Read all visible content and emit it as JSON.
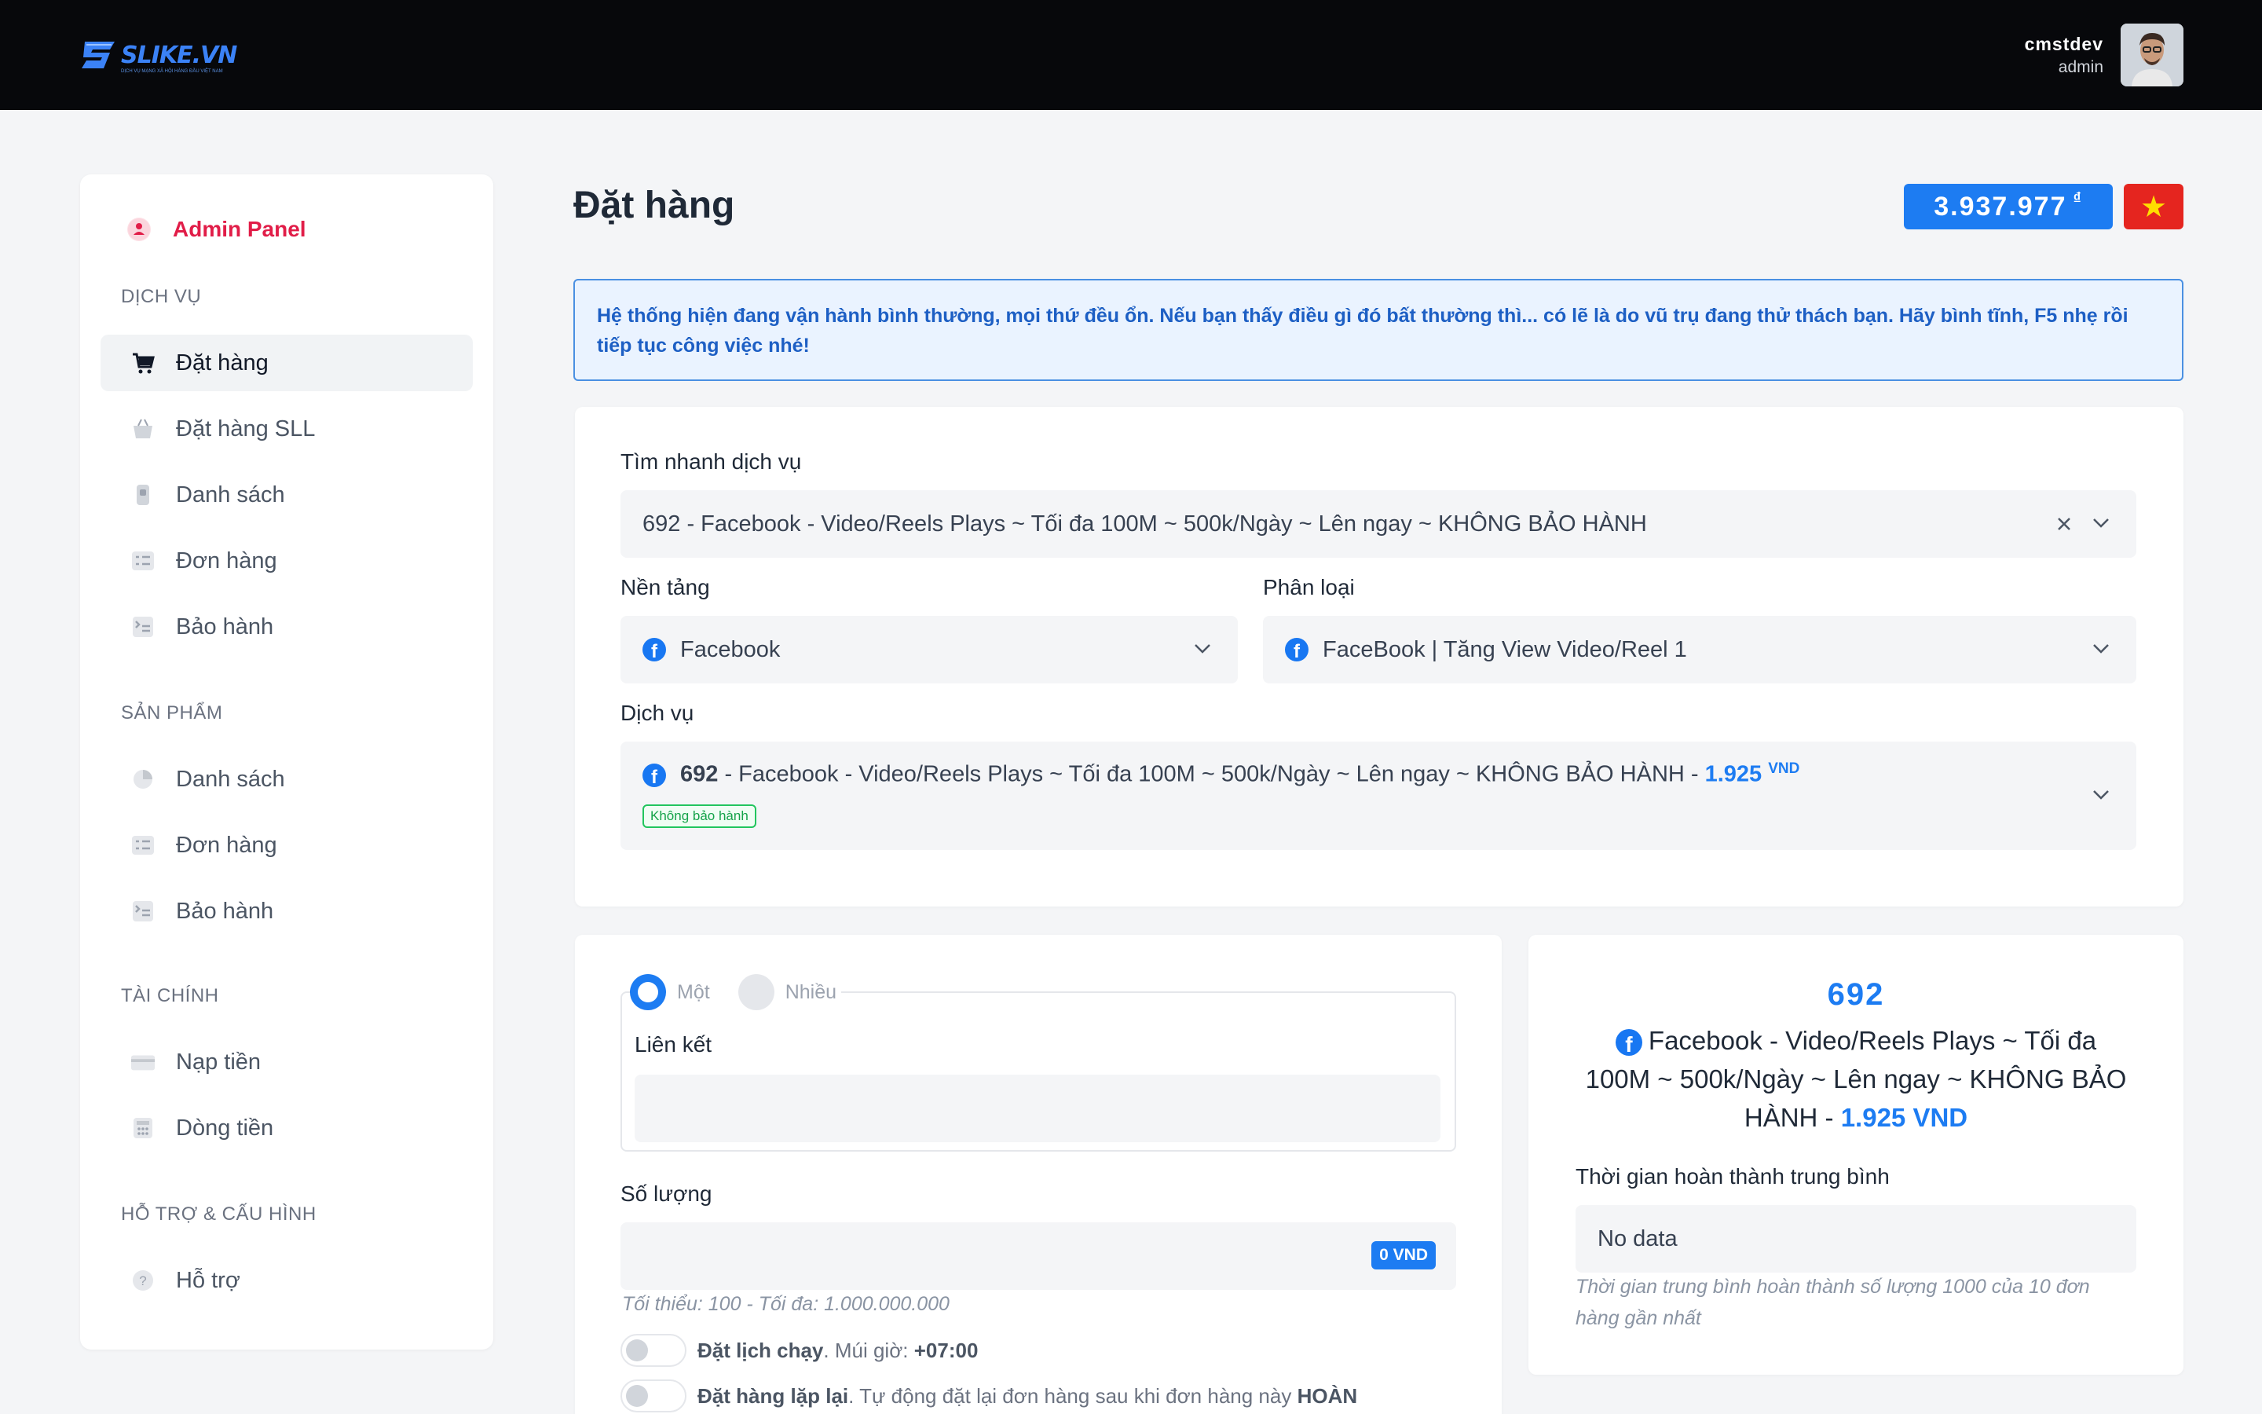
{
  "header": {
    "logo_text": "SLIKE.VN",
    "logo_tagline": "DỊCH VỤ MẠNG XÃ HỘI HÀNG ĐẦU VIỆT NAM",
    "user_name": "cmstdev",
    "user_role": "admin"
  },
  "sidebar": {
    "admin_label": "Admin Panel",
    "sections": {
      "dich_vu": "DỊCH VỤ",
      "san_pham": "SẢN PHẨM",
      "tai_chinh": "TÀI CHÍNH",
      "ho_tro": "HỖ TRỢ & CẤU HÌNH"
    },
    "items": {
      "dat_hang": "Đặt hàng",
      "dat_hang_sll": "Đặt hàng SLL",
      "danh_sach": "Danh sách",
      "don_hang": "Đơn hàng",
      "bao_hanh": "Bảo hành",
      "sp_danh_sach": "Danh sách",
      "sp_don_hang": "Đơn hàng",
      "sp_bao_hanh": "Bảo hành",
      "nap_tien": "Nạp tiền",
      "dong_tien": "Dòng tiền",
      "ho_tro": "Hỗ trợ"
    }
  },
  "page": {
    "title": "Đặt hàng",
    "balance": "3.937.977",
    "currency_symbol": "₫",
    "flag_star": "★",
    "notice": "Hệ thống hiện đang vận hành bình thường, mọi thứ đều ổn. Nếu bạn thấy điều gì đó bất thường thì... có lẽ là do vũ trụ đang thử thách bạn. Hãy bình tĩnh, F5 nhẹ rồi tiếp tục công việc nhé!"
  },
  "form": {
    "quick_search_label": "Tìm nhanh dịch vụ",
    "quick_search_value": "692 - Facebook - Video/Reels Plays ~ Tối đa 100M ~ 500k/Ngày ~ Lên ngay ~ KHÔNG BẢO HÀNH",
    "platform_label": "Nền tảng",
    "platform_value": "Facebook",
    "category_label": "Phân loại",
    "category_value": "FaceBook | Tăng View Video/Reel 1",
    "service_label": "Dịch vụ",
    "service_id": "692",
    "service_name": " - Facebook - Video/Reels Plays ~ Tối đa 100M ~ 500k/Ngày ~ Lên ngay ~ KHÔNG BẢO HÀNH - ",
    "service_price": "1.925",
    "service_currency": "VND",
    "service_badge": "Không bảo hành"
  },
  "order": {
    "mode_one": "Một",
    "mode_many": "Nhiều",
    "link_label": "Liên kết",
    "link_value": "",
    "quantity_label": "Số lượng",
    "quantity_value": "",
    "total_badge": "0 VND",
    "min_max": "Tối thiểu: 100 - Tối đa: 1.000.000.000",
    "schedule_bold": "Đặt lịch chạy",
    "schedule_rest": ". Múi giờ: ",
    "schedule_tz": "+07:00",
    "repeat_bold": "Đặt hàng lặp lại",
    "repeat_rest": ". Tự động đặt lại đơn hàng sau khi đơn hàng này ",
    "repeat_end": "HOÀN"
  },
  "info": {
    "service_id": "692",
    "service_name": "Facebook - Video/Reels Plays ~ Tối đa 100M ~ 500k/Ngày ~ Lên ngay ~ KHÔNG BẢO HÀNH - ",
    "service_price": "1.925 VND",
    "avg_time_label": "Thời gian hoàn thành trung bình",
    "avg_time_value": "No data",
    "avg_time_note": "Thời gian trung bình hoàn thành số lượng 1000 của 10 đơn hàng gần nhất"
  },
  "colors": {
    "accent": "#1d7cf2",
    "admin": "#e11d48",
    "badge_green": "#22c55e",
    "topbar": "#07080b"
  }
}
